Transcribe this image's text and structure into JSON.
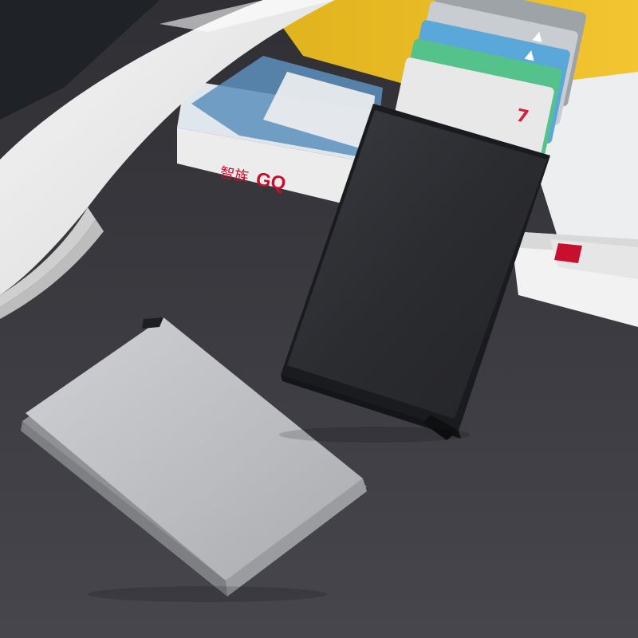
{
  "scene": {
    "description_free": true,
    "magazine": {
      "spine_chinese_text": "智族",
      "spine_brand_text": "GQ",
      "brand_color": "#c8102e"
    },
    "cards": [
      {
        "color": "#9ea3a8",
        "glyph": "▲"
      },
      {
        "color": "#c9ccd0",
        "glyph": "▲"
      },
      {
        "color": "#5aa7d9",
        "glyph": ""
      },
      {
        "color": "#54c28a",
        "glyph": ""
      },
      {
        "color": "#e8e8e8",
        "glyph": "7"
      }
    ],
    "wallets": [
      {
        "name": "black-card-holder",
        "color": "#2b2c30"
      },
      {
        "name": "silver-card-holder",
        "color": "#b9bbbf"
      }
    ],
    "table_color": "#3a3a3f"
  }
}
